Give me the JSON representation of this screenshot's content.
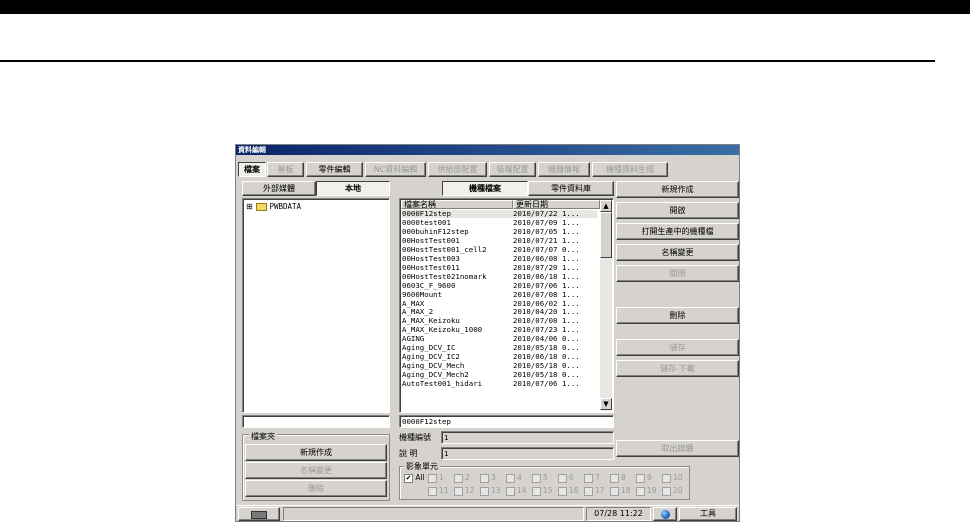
{
  "window": {
    "title": "資料編輯"
  },
  "menu": [
    {
      "label": "檔案",
      "state": "pressed"
    },
    {
      "label": "基板",
      "state": "dis"
    },
    {
      "label": "零件編輯",
      "state": "normal"
    },
    {
      "label": "NC資料編輯",
      "state": "dis"
    },
    {
      "label": "供給部配置",
      "state": "dis"
    },
    {
      "label": "吸嘴配置",
      "state": "dis"
    },
    {
      "label": "機器情報",
      "state": "dis"
    },
    {
      "label": "機種資料生成",
      "state": "dis"
    }
  ],
  "left_tabs": {
    "external": "外部媒體",
    "local": "本地"
  },
  "tree": {
    "root": "PWBDATA",
    "expander": "⊞"
  },
  "mid_tabs": {
    "model": "機種檔案",
    "parts_db": "零件資料庫"
  },
  "file_list": {
    "col_name": "檔案名稱",
    "col_date": "更新日期",
    "rows": [
      {
        "name": "0000F12step",
        "date": "2010/07/22 1..."
      },
      {
        "name": "0000test001",
        "date": "2010/07/09 1..."
      },
      {
        "name": "000buhinF12step",
        "date": "2010/07/05 1..."
      },
      {
        "name": "00HostTest001",
        "date": "2010/07/21 1..."
      },
      {
        "name": "00HostTest001_cell2",
        "date": "2010/07/07 0..."
      },
      {
        "name": "00HostTest003",
        "date": "2010/06/08 1..."
      },
      {
        "name": "00HostTest011",
        "date": "2010/07/20 1..."
      },
      {
        "name": "00HostTest021nomark",
        "date": "2010/06/18 1..."
      },
      {
        "name": "0603C_F_9600",
        "date": "2010/07/06 1..."
      },
      {
        "name": "9600Mount",
        "date": "2010/07/08 1..."
      },
      {
        "name": "A_MAX",
        "date": "2010/06/02 1..."
      },
      {
        "name": "A_MAX_2",
        "date": "2010/04/20 1..."
      },
      {
        "name": "A_MAX_Keizoku",
        "date": "2010/07/08 1..."
      },
      {
        "name": "A_MAX_Keizoku_1000",
        "date": "2010/07/23 1..."
      },
      {
        "name": "AGING",
        "date": "2010/04/06 0..."
      },
      {
        "name": "Aging_DCV_IC",
        "date": "2010/05/18 0..."
      },
      {
        "name": "Aging_DCV_IC2",
        "date": "2010/06/18 0..."
      },
      {
        "name": "Aging_DCV_Mech",
        "date": "2010/05/18 0..."
      },
      {
        "name": "Aging_DCV_Mech2",
        "date": "2010/05/18 0..."
      },
      {
        "name": "AutoTest001_hidari",
        "date": "2010/07/06 1..."
      }
    ],
    "selected_name": "0000F12step",
    "scroll_up": "▲",
    "scroll_down": "▼"
  },
  "right_buttons": [
    {
      "label": "新規作成",
      "state": "normal"
    },
    {
      "label": "開啟",
      "state": "normal"
    },
    {
      "label": "打開生產中的機種檔",
      "state": "normal"
    },
    {
      "label": "名稱變更",
      "state": "normal"
    },
    {
      "label": "關閉",
      "state": "dis"
    },
    {
      "label": "刪除",
      "state": "normal"
    },
    {
      "label": "儲存",
      "state": "dis"
    },
    {
      "label": "儲存-下載",
      "state": "dis"
    },
    {
      "label": "取出媒體",
      "state": "dis"
    }
  ],
  "folder_group": {
    "title": "檔案夾",
    "new": "新規作成",
    "rename": "名稱變更",
    "delete": "刪除"
  },
  "info": {
    "model_no_label": "機種編號",
    "model_no_value": "1",
    "desc_label": "說 明",
    "desc_value": "1"
  },
  "camera_group": {
    "title": "影象單元",
    "all_label": "All",
    "all_checked": "✔",
    "row1": [
      "1",
      "2",
      "3",
      "4",
      "5",
      "6",
      "7",
      "8",
      "9",
      "10"
    ],
    "row2": [
      "11",
      "12",
      "13",
      "14",
      "15",
      "16",
      "17",
      "18",
      "19",
      "20"
    ]
  },
  "statusbar": {
    "datetime": "07/28 11:22",
    "tools": "工具"
  }
}
